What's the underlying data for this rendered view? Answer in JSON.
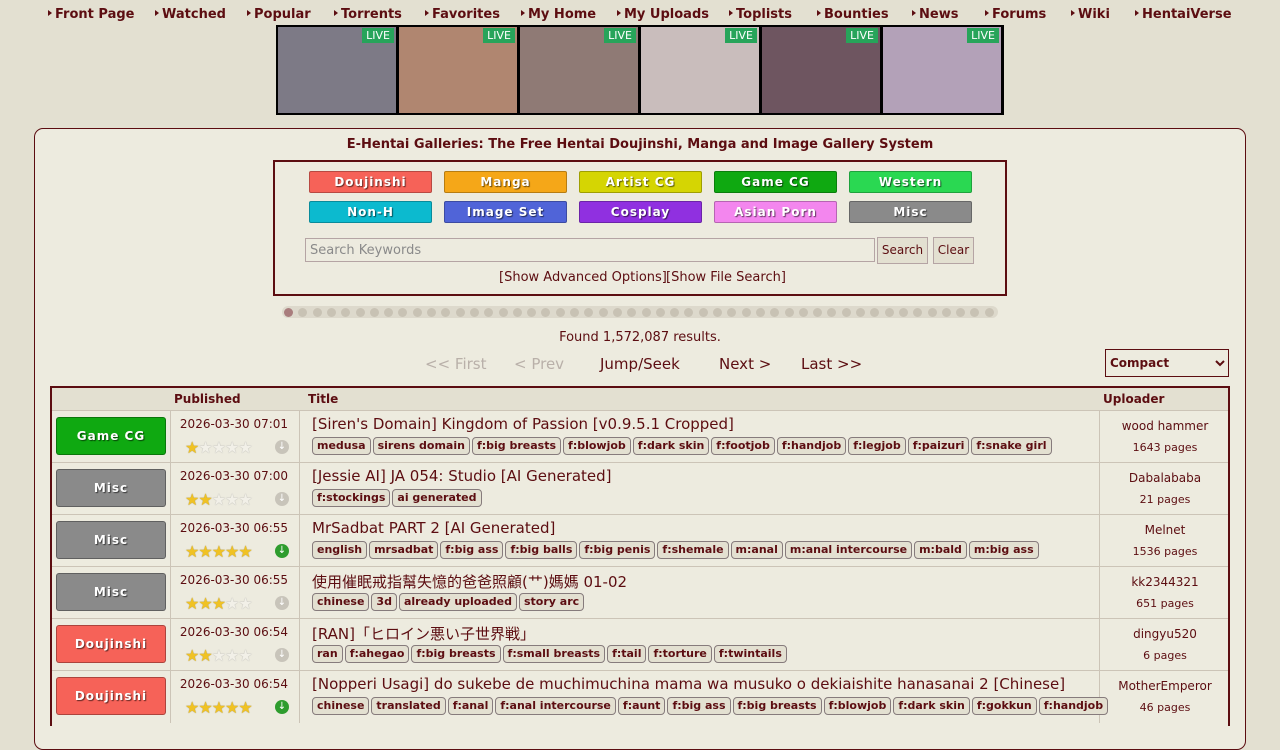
{
  "nav": [
    "Front Page",
    "Watched",
    "Popular",
    "Torrents",
    "Favorites",
    "My Home",
    "My Uploads",
    "Toplists",
    "Bounties",
    "News",
    "Forums",
    "Wiki",
    "HentaiVerse"
  ],
  "live": {
    "badge": "LIVE",
    "thumbs": [
      {
        "name": "thumb-1",
        "color": "#7d7a86"
      },
      {
        "name": "thumb-2",
        "color": "#b08670"
      },
      {
        "name": "thumb-3",
        "color": "#8f7a75"
      },
      {
        "name": "thumb-4",
        "color": "#c9bdbc"
      },
      {
        "name": "thumb-5",
        "color": "#6e5560"
      },
      {
        "name": "thumb-6",
        "color": "#b3a1b8"
      }
    ]
  },
  "site_title": "E-Hentai Galleries: The Free Hentai Doujinshi, Manga and Image Gallery System",
  "categories": [
    {
      "label": "Doujinshi",
      "color": "#f66258"
    },
    {
      "label": "Manga",
      "color": "#f5a718"
    },
    {
      "label": "Artist CG",
      "color": "#d5d503"
    },
    {
      "label": "Game CG",
      "color": "#0fa911"
    },
    {
      "label": "Western",
      "color": "#2ad852"
    },
    {
      "label": "Non-H",
      "color": "#0cbacf"
    },
    {
      "label": "Image Set",
      "color": "#5064d8"
    },
    {
      "label": "Cosplay",
      "color": "#9030e0"
    },
    {
      "label": "Asian Porn",
      "color": "#f386ee"
    },
    {
      "label": "Misc",
      "color": "#8a8a8a"
    }
  ],
  "search": {
    "placeholder": "Search Keywords",
    "search_label": "Search",
    "clear_label": "Clear"
  },
  "advanced_label": "[Show Advanced Options]",
  "file_search_label": "[Show File Search]",
  "carousel_active": 0,
  "found_text": "Found 1,572,087 results.",
  "pager": {
    "first": "<< First",
    "prev": "< Prev",
    "jump": "Jump/Seek",
    "next": "Next >",
    "last": "Last >>"
  },
  "view_mode": "Compact",
  "table_headers": {
    "published": "Published",
    "title": "Title",
    "uploader": "Uploader"
  },
  "galleries": [
    {
      "category": "Game CG",
      "cat_color": "#0fa911",
      "posted": "2026-03-30 07:01",
      "rating": 1,
      "downloadable": false,
      "title": "[Siren's Domain] Kingdom of Passion [v0.9.5.1 Cropped]",
      "tags": [
        "medusa",
        "sirens domain",
        "f:big breasts",
        "f:blowjob",
        "f:dark skin",
        "f:footjob",
        "f:handjob",
        "f:legjob",
        "f:paizuri",
        "f:snake girl"
      ],
      "uploader": "wood hammer",
      "pages": "1643 pages"
    },
    {
      "category": "Misc",
      "cat_color": "#8a8a8a",
      "posted": "2026-03-30 07:00",
      "rating": 2,
      "downloadable": false,
      "title": "[Jessie AI] JA 054: Studio [AI Generated]",
      "tags": [
        "f:stockings",
        "ai generated"
      ],
      "uploader": "Dabalababa",
      "pages": "21 pages"
    },
    {
      "category": "Misc",
      "cat_color": "#8a8a8a",
      "posted": "2026-03-30 06:55",
      "rating": 4.5,
      "downloadable": true,
      "title": "MrSadbat PART 2 [AI Generated]",
      "tags": [
        "english",
        "mrsadbat",
        "f:big ass",
        "f:big balls",
        "f:big penis",
        "f:shemale",
        "m:anal",
        "m:anal intercourse",
        "m:bald",
        "m:big ass"
      ],
      "uploader": "Melnet",
      "pages": "1536 pages"
    },
    {
      "category": "Misc",
      "cat_color": "#8a8a8a",
      "posted": "2026-03-30 06:55",
      "rating": 2.5,
      "downloadable": false,
      "title": "使用催眠戒指幫失憶的爸爸照顧(艹)媽媽 01-02",
      "tags": [
        "chinese",
        "3d",
        "already uploaded",
        "story arc"
      ],
      "uploader": "kk2344321",
      "pages": "651 pages"
    },
    {
      "category": "Doujinshi",
      "cat_color": "#f66258",
      "posted": "2026-03-30 06:54",
      "rating": 2,
      "downloadable": false,
      "title": "[RAN]「ヒロイン悪い子世界戦」",
      "tags": [
        "ran",
        "f:ahegao",
        "f:big breasts",
        "f:small breasts",
        "f:tail",
        "f:torture",
        "f:twintails"
      ],
      "uploader": "dingyu520",
      "pages": "6 pages"
    },
    {
      "category": "Doujinshi",
      "cat_color": "#f66258",
      "posted": "2026-03-30 06:54",
      "rating": 4.5,
      "downloadable": true,
      "title": "[Nopperi Usagi] do sukebe de muchimuchina mama wa musuko o dekiaishite hanasanai 2 [Chinese]",
      "tags": [
        "chinese",
        "translated",
        "f:anal",
        "f:anal intercourse",
        "f:aunt",
        "f:big ass",
        "f:big breasts",
        "f:blowjob",
        "f:dark skin",
        "f:gokkun",
        "f:handjob"
      ],
      "uploader": "MotherEmperor",
      "pages": "46 pages"
    }
  ]
}
